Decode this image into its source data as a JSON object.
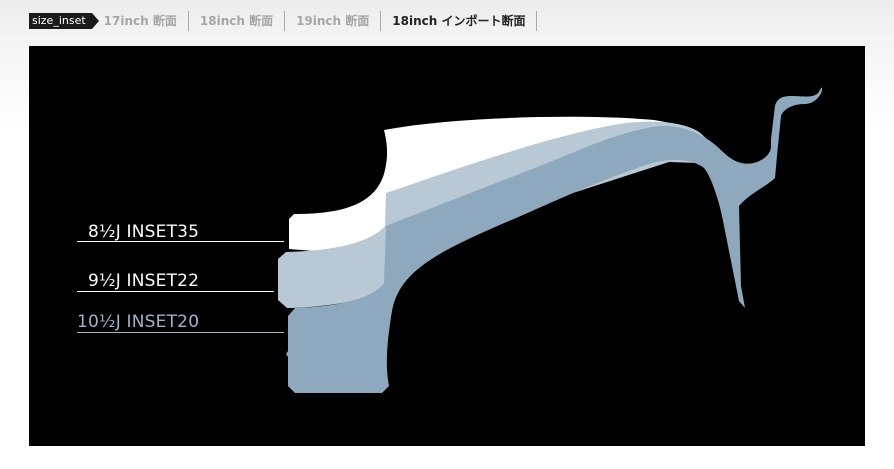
{
  "header": {
    "tag_label": "size_inset",
    "tabs": [
      {
        "label": "17inch 断面",
        "active": false
      },
      {
        "label": "18inch 断面",
        "active": false
      },
      {
        "label": "19inch 断面",
        "active": false
      },
      {
        "label": "18inch インポート断面",
        "active": true
      }
    ]
  },
  "diagram": {
    "labels": [
      {
        "text": "8½J INSET35",
        "color": "#ffffff"
      },
      {
        "text": "9½J INSET22",
        "color": "#ffffff"
      },
      {
        "text": "10½J INSET20",
        "color": "#9db4ca"
      }
    ],
    "colors": {
      "background": "#000000",
      "profile_8_5": "#ffffff",
      "profile_9_5": "#b8c8d4",
      "profile_10_5": "#8ea8bd"
    }
  }
}
